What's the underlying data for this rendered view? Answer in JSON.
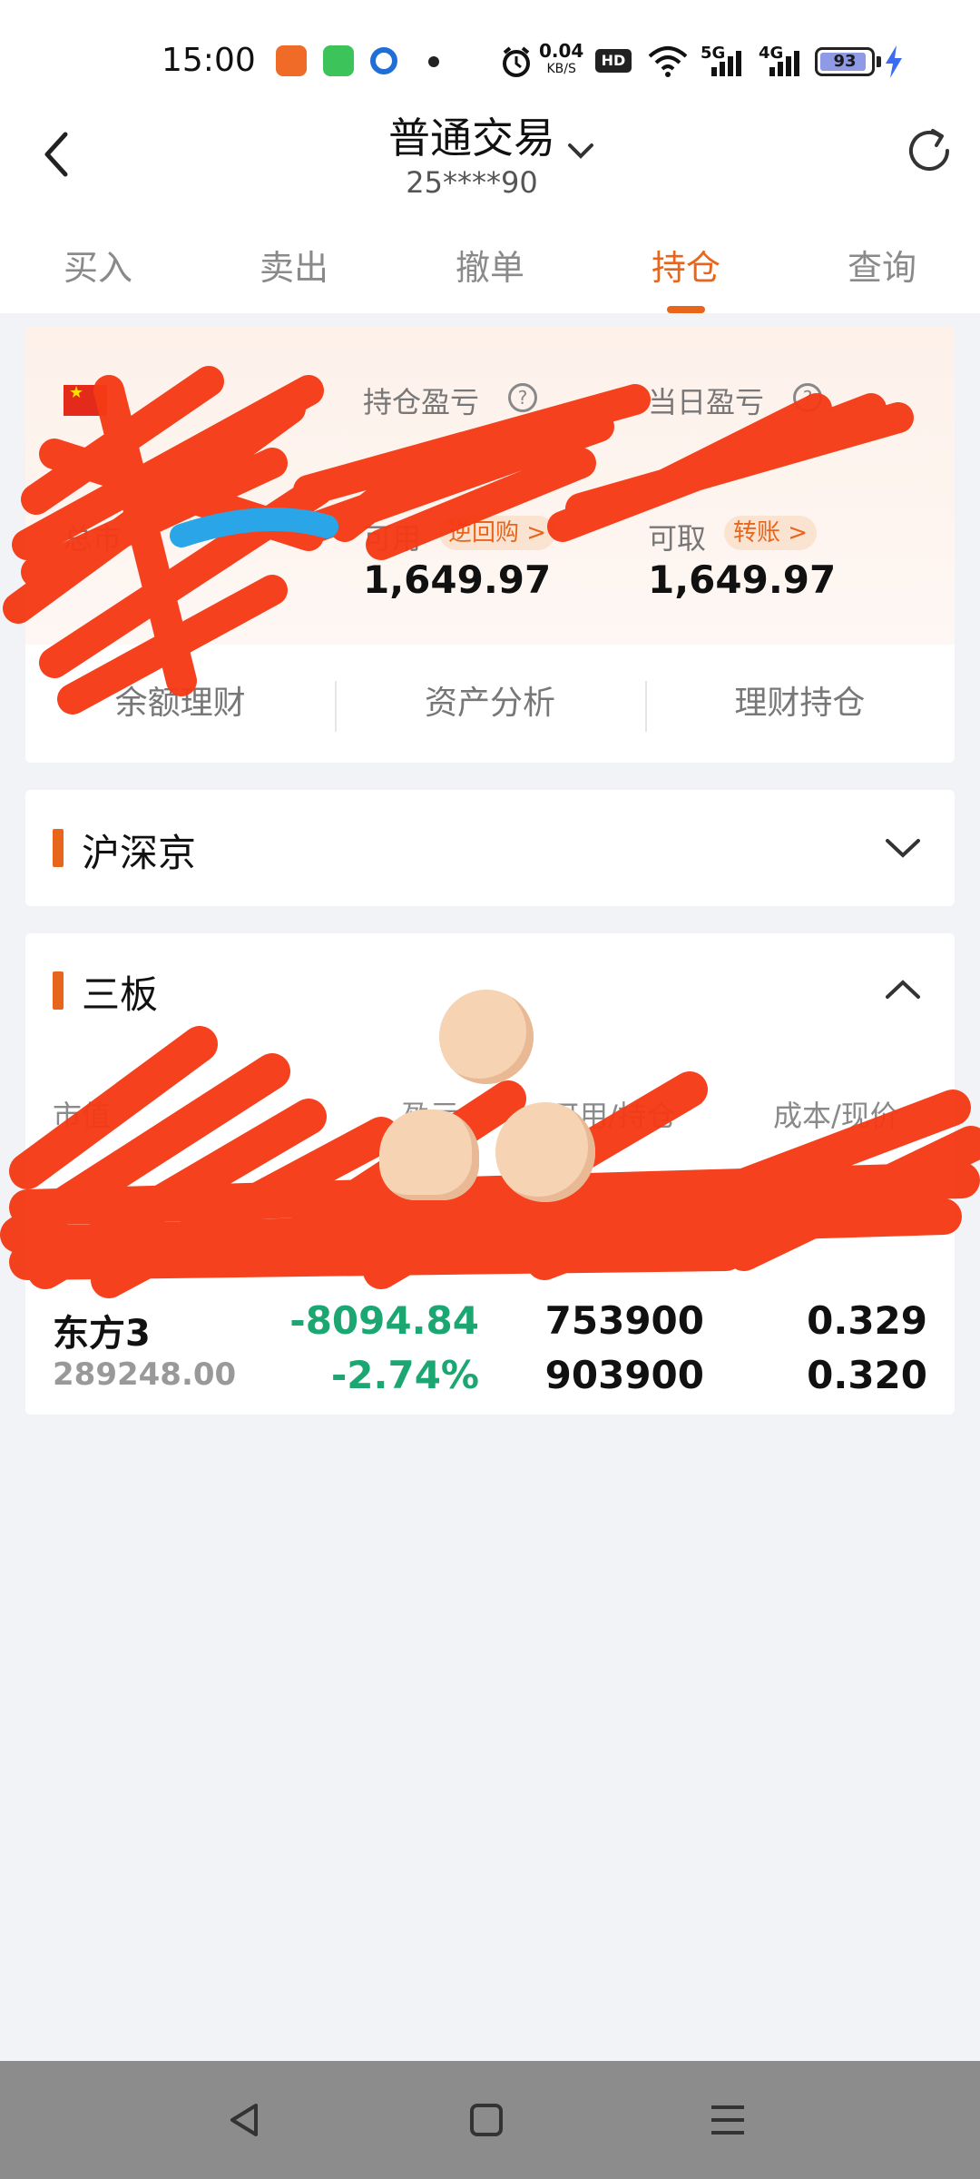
{
  "status_bar": {
    "time": "15:00",
    "net_speed_value": "0.04",
    "net_speed_unit": "KB/S",
    "hd_label": "HD",
    "sim1_label": "5G",
    "sim2_label": "4G",
    "battery": "93",
    "icons": [
      "app-icon-orange",
      "message-icon",
      "browser-icon",
      "alarm-icon",
      "wifi-icon",
      "signal-icon",
      "charging-icon"
    ]
  },
  "header": {
    "title": "普通交易",
    "account": "25****90"
  },
  "tabs": [
    {
      "label": "买入",
      "active": false
    },
    {
      "label": "卖出",
      "active": false
    },
    {
      "label": "撤单",
      "active": false
    },
    {
      "label": "持仓",
      "active": true
    },
    {
      "label": "查询",
      "active": false
    }
  ],
  "summary": {
    "holding_pl_label": "持仓盈亏",
    "daily_pl_label": "当日盈亏",
    "total_label": "总市",
    "available_label": "可用",
    "reverse_repo_chip": "逆回购 >",
    "available_value": "1,649.97",
    "withdrawable_label": "可取",
    "transfer_chip": "转账 >",
    "withdrawable_value": "1,649.97",
    "links": [
      "余额理财",
      "资产分析",
      "理财持仓"
    ]
  },
  "sections": {
    "hsj": {
      "title": "沪深京",
      "expanded": false
    },
    "sanban": {
      "title": "三板",
      "expanded": true,
      "columns": [
        "市值",
        "盈亏",
        "可用/持仓",
        "成本/现价"
      ],
      "rows": [
        {
          "name": "东方3",
          "market_value": "289248.00",
          "pl": "-8094.84",
          "pl_pct": "-2.74%",
          "available": "753900",
          "holding": "903900",
          "cost": "0.329",
          "price": "0.320"
        }
      ]
    }
  },
  "colors": {
    "accent": "#e8661c",
    "loss_green": "#1ba672",
    "redaction": "#f53a15"
  }
}
